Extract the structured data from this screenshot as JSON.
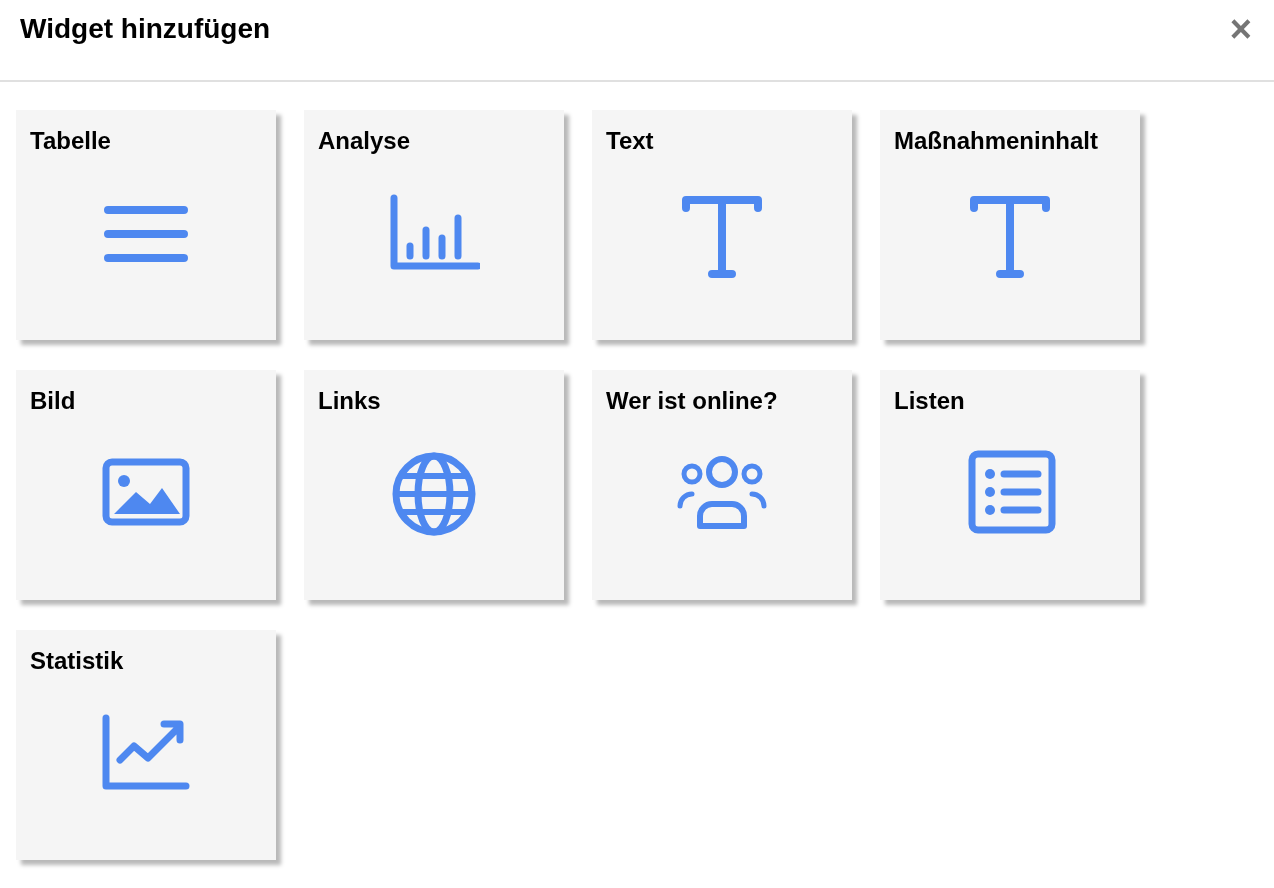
{
  "dialog": {
    "title": "Widget hinzufügen",
    "close": "×"
  },
  "widgets": [
    {
      "label": "Tabelle",
      "kind": "lines"
    },
    {
      "label": "Analyse",
      "kind": "bars"
    },
    {
      "label": "Text",
      "kind": "text"
    },
    {
      "label": "Maßnahmeninhalt",
      "kind": "text"
    },
    {
      "label": "Bild",
      "kind": "image"
    },
    {
      "label": "Links",
      "kind": "globe"
    },
    {
      "label": "Wer ist online?",
      "kind": "users"
    },
    {
      "label": "Listen",
      "kind": "list"
    },
    {
      "label": "Statistik",
      "kind": "trend"
    }
  ]
}
